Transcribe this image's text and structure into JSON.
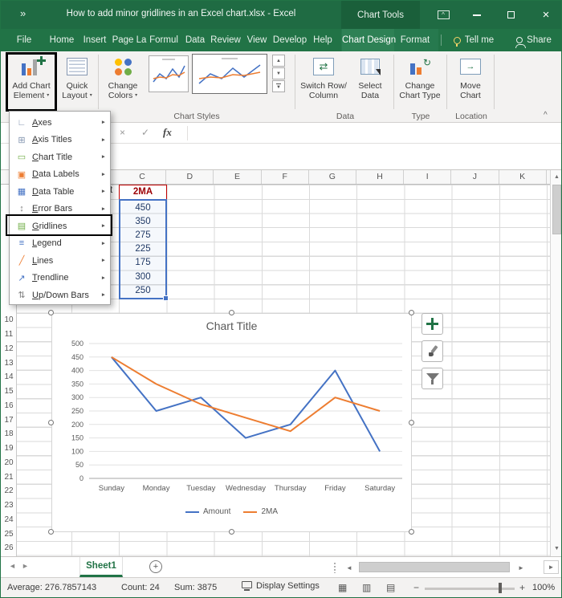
{
  "glyphs": {
    "expand": "»",
    "close": "×",
    "caret": "▾",
    "submenu": "►",
    "up": "▲",
    "down": "▼",
    "left": "◄",
    "right": "►",
    "check": "✓",
    "cancel": "×",
    "hat": "^",
    "plus": "+",
    "swap": "⇄",
    "refresh": "↻",
    "arrow": "→",
    "view_normal": "▦",
    "view_layout": "▥",
    "view_break": "▤",
    "minus": "−"
  },
  "window": {
    "title": "How to add minor gridlines in an Excel chart.xlsx  -  Excel",
    "contextual_group": "Chart Tools"
  },
  "menu": {
    "tabs": [
      {
        "label": "File"
      },
      {
        "label": "Home"
      },
      {
        "label": "Insert"
      },
      {
        "label": "Page La"
      },
      {
        "label": "Formul"
      },
      {
        "label": "Data"
      },
      {
        "label": "Review"
      },
      {
        "label": "View"
      },
      {
        "label": "Develop"
      },
      {
        "label": "Help"
      },
      {
        "label": "Chart Design"
      },
      {
        "label": "Format"
      }
    ],
    "tell_me": "Tell me",
    "share": "Share"
  },
  "ribbon": {
    "add_chart_element": {
      "line1": "Add Chart",
      "line2": "Element"
    },
    "quick_layout": {
      "line1": "Quick",
      "line2": "Layout"
    },
    "change_colors": {
      "line1": "Change",
      "line2": "Colors"
    },
    "switch_row_column": {
      "line1": "Switch Row/",
      "line2": "Column"
    },
    "select_data": {
      "line1": "Select",
      "line2": "Data"
    },
    "change_chart_type": {
      "line1": "Change",
      "line2": "Chart Type"
    },
    "move_chart": {
      "line1": "Move",
      "line2": "Chart"
    },
    "groups": {
      "chart_styles": "Chart Styles",
      "data": "Data",
      "type": "Type",
      "location": "Location"
    }
  },
  "dropdown": {
    "items": [
      {
        "label": "Axes",
        "glyph": "∟"
      },
      {
        "label": "Axis Titles",
        "glyph": "⊞"
      },
      {
        "label": "Chart Title",
        "glyph": "▭"
      },
      {
        "label": "Data Labels",
        "glyph": "▣"
      },
      {
        "label": "Data Table",
        "glyph": "▦"
      },
      {
        "label": "Error Bars",
        "glyph": "↕"
      },
      {
        "label": "Gridlines",
        "glyph": "▤"
      },
      {
        "label": "Legend",
        "glyph": "≡"
      },
      {
        "label": "Lines",
        "glyph": "╱"
      },
      {
        "label": "Trendline",
        "glyph": "↗"
      },
      {
        "label": "Up/Down Bars",
        "glyph": "⇅"
      }
    ]
  },
  "formula_bar": {
    "fx": "fx"
  },
  "sheet": {
    "column_headers": [
      "C",
      "D",
      "E",
      "F",
      "G",
      "H",
      "I",
      "J",
      "K"
    ],
    "row_numbers": [
      "10",
      "11",
      "12",
      "13",
      "14",
      "15",
      "16",
      "17",
      "18",
      "19",
      "20",
      "21",
      "22",
      "23",
      "24",
      "25",
      "26"
    ],
    "b1_partial": "t",
    "c1_header": "2MA",
    "c_values": [
      "450",
      "350",
      "275",
      "225",
      "175",
      "300",
      "250"
    ]
  },
  "chart_data": {
    "type": "line",
    "title": "Chart Title",
    "categories": [
      "Sunday",
      "Monday",
      "Tuesday",
      "Wednesday",
      "Thursday",
      "Friday",
      "Saturday"
    ],
    "series": [
      {
        "name": "Amount",
        "color": "#4472c4",
        "values": [
          450,
          250,
          300,
          150,
          200,
          400,
          100
        ]
      },
      {
        "name": "2MA",
        "color": "#ed7d31",
        "values": [
          450,
          350,
          275,
          225,
          175,
          300,
          250
        ]
      }
    ],
    "ylim": [
      0,
      500
    ],
    "ytick_step": 50,
    "grid": true,
    "legend_position": "bottom"
  },
  "tab_bar": {
    "sheet_name": "Sheet1"
  },
  "status_bar": {
    "average": "Average: 276.7857143",
    "count": "Count: 24",
    "sum": "Sum: 3875",
    "display_settings": "Display Settings",
    "zoom_level": "100%"
  }
}
